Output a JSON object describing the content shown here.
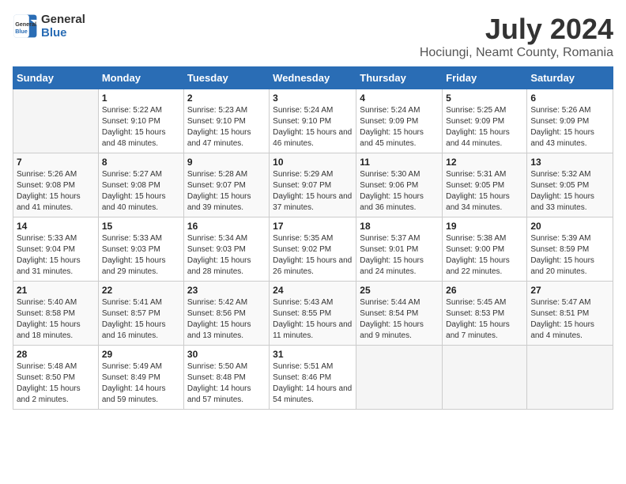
{
  "header": {
    "logo_general": "General",
    "logo_blue": "Blue",
    "title": "July 2024",
    "subtitle": "Hociungi, Neamt County, Romania"
  },
  "days_of_week": [
    "Sunday",
    "Monday",
    "Tuesday",
    "Wednesday",
    "Thursday",
    "Friday",
    "Saturday"
  ],
  "weeks": [
    [
      {
        "day": "",
        "info": ""
      },
      {
        "day": "1",
        "info": "Sunrise: 5:22 AM\nSunset: 9:10 PM\nDaylight: 15 hours and 48 minutes."
      },
      {
        "day": "2",
        "info": "Sunrise: 5:23 AM\nSunset: 9:10 PM\nDaylight: 15 hours and 47 minutes."
      },
      {
        "day": "3",
        "info": "Sunrise: 5:24 AM\nSunset: 9:10 PM\nDaylight: 15 hours and 46 minutes."
      },
      {
        "day": "4",
        "info": "Sunrise: 5:24 AM\nSunset: 9:09 PM\nDaylight: 15 hours and 45 minutes."
      },
      {
        "day": "5",
        "info": "Sunrise: 5:25 AM\nSunset: 9:09 PM\nDaylight: 15 hours and 44 minutes."
      },
      {
        "day": "6",
        "info": "Sunrise: 5:26 AM\nSunset: 9:09 PM\nDaylight: 15 hours and 43 minutes."
      }
    ],
    [
      {
        "day": "7",
        "info": "Sunrise: 5:26 AM\nSunset: 9:08 PM\nDaylight: 15 hours and 41 minutes."
      },
      {
        "day": "8",
        "info": "Sunrise: 5:27 AM\nSunset: 9:08 PM\nDaylight: 15 hours and 40 minutes."
      },
      {
        "day": "9",
        "info": "Sunrise: 5:28 AM\nSunset: 9:07 PM\nDaylight: 15 hours and 39 minutes."
      },
      {
        "day": "10",
        "info": "Sunrise: 5:29 AM\nSunset: 9:07 PM\nDaylight: 15 hours and 37 minutes."
      },
      {
        "day": "11",
        "info": "Sunrise: 5:30 AM\nSunset: 9:06 PM\nDaylight: 15 hours and 36 minutes."
      },
      {
        "day": "12",
        "info": "Sunrise: 5:31 AM\nSunset: 9:05 PM\nDaylight: 15 hours and 34 minutes."
      },
      {
        "day": "13",
        "info": "Sunrise: 5:32 AM\nSunset: 9:05 PM\nDaylight: 15 hours and 33 minutes."
      }
    ],
    [
      {
        "day": "14",
        "info": "Sunrise: 5:33 AM\nSunset: 9:04 PM\nDaylight: 15 hours and 31 minutes."
      },
      {
        "day": "15",
        "info": "Sunrise: 5:33 AM\nSunset: 9:03 PM\nDaylight: 15 hours and 29 minutes."
      },
      {
        "day": "16",
        "info": "Sunrise: 5:34 AM\nSunset: 9:03 PM\nDaylight: 15 hours and 28 minutes."
      },
      {
        "day": "17",
        "info": "Sunrise: 5:35 AM\nSunset: 9:02 PM\nDaylight: 15 hours and 26 minutes."
      },
      {
        "day": "18",
        "info": "Sunrise: 5:37 AM\nSunset: 9:01 PM\nDaylight: 15 hours and 24 minutes."
      },
      {
        "day": "19",
        "info": "Sunrise: 5:38 AM\nSunset: 9:00 PM\nDaylight: 15 hours and 22 minutes."
      },
      {
        "day": "20",
        "info": "Sunrise: 5:39 AM\nSunset: 8:59 PM\nDaylight: 15 hours and 20 minutes."
      }
    ],
    [
      {
        "day": "21",
        "info": "Sunrise: 5:40 AM\nSunset: 8:58 PM\nDaylight: 15 hours and 18 minutes."
      },
      {
        "day": "22",
        "info": "Sunrise: 5:41 AM\nSunset: 8:57 PM\nDaylight: 15 hours and 16 minutes."
      },
      {
        "day": "23",
        "info": "Sunrise: 5:42 AM\nSunset: 8:56 PM\nDaylight: 15 hours and 13 minutes."
      },
      {
        "day": "24",
        "info": "Sunrise: 5:43 AM\nSunset: 8:55 PM\nDaylight: 15 hours and 11 minutes."
      },
      {
        "day": "25",
        "info": "Sunrise: 5:44 AM\nSunset: 8:54 PM\nDaylight: 15 hours and 9 minutes."
      },
      {
        "day": "26",
        "info": "Sunrise: 5:45 AM\nSunset: 8:53 PM\nDaylight: 15 hours and 7 minutes."
      },
      {
        "day": "27",
        "info": "Sunrise: 5:47 AM\nSunset: 8:51 PM\nDaylight: 15 hours and 4 minutes."
      }
    ],
    [
      {
        "day": "28",
        "info": "Sunrise: 5:48 AM\nSunset: 8:50 PM\nDaylight: 15 hours and 2 minutes."
      },
      {
        "day": "29",
        "info": "Sunrise: 5:49 AM\nSunset: 8:49 PM\nDaylight: 14 hours and 59 minutes."
      },
      {
        "day": "30",
        "info": "Sunrise: 5:50 AM\nSunset: 8:48 PM\nDaylight: 14 hours and 57 minutes."
      },
      {
        "day": "31",
        "info": "Sunrise: 5:51 AM\nSunset: 8:46 PM\nDaylight: 14 hours and 54 minutes."
      },
      {
        "day": "",
        "info": ""
      },
      {
        "day": "",
        "info": ""
      },
      {
        "day": "",
        "info": ""
      }
    ]
  ]
}
